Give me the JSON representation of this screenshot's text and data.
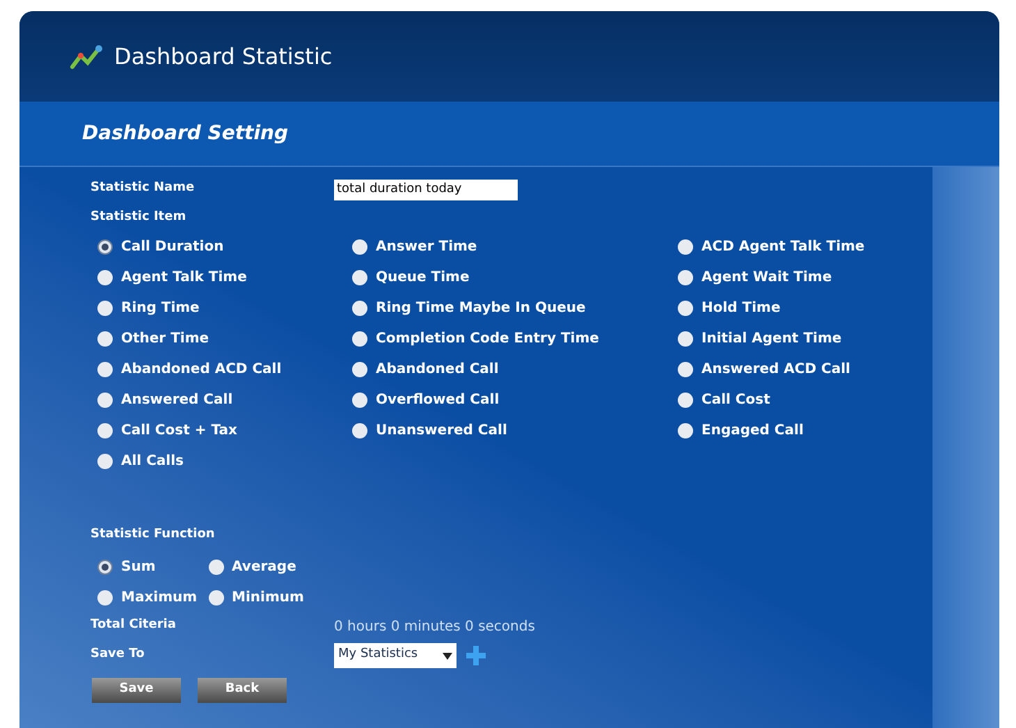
{
  "app": {
    "title": "Dashboard Statistic"
  },
  "section": {
    "title": "Dashboard Setting"
  },
  "statistic_name": {
    "label": "Statistic Name",
    "value": "total duration today"
  },
  "statistic_item": {
    "label": "Statistic Item",
    "options": [
      {
        "label": "Call Duration",
        "selected": true
      },
      {
        "label": "Answer Time",
        "selected": false
      },
      {
        "label": "ACD Agent Talk Time",
        "selected": false
      },
      {
        "label": "Agent Talk Time",
        "selected": false
      },
      {
        "label": "Queue Time",
        "selected": false
      },
      {
        "label": "Agent Wait Time",
        "selected": false
      },
      {
        "label": "Ring Time",
        "selected": false
      },
      {
        "label": "Ring Time Maybe In Queue",
        "selected": false
      },
      {
        "label": "Hold Time",
        "selected": false
      },
      {
        "label": "Other Time",
        "selected": false
      },
      {
        "label": "Completion Code Entry Time",
        "selected": false
      },
      {
        "label": "Initial Agent Time",
        "selected": false
      },
      {
        "label": "Abandoned ACD Call",
        "selected": false
      },
      {
        "label": "Abandoned Call",
        "selected": false
      },
      {
        "label": "Answered ACD Call",
        "selected": false
      },
      {
        "label": "Answered Call",
        "selected": false
      },
      {
        "label": "Overflowed Call",
        "selected": false
      },
      {
        "label": "Call Cost",
        "selected": false
      },
      {
        "label": "Call Cost + Tax",
        "selected": false
      },
      {
        "label": "Unanswered Call",
        "selected": false
      },
      {
        "label": "Engaged Call",
        "selected": false
      },
      {
        "label": "All Calls",
        "selected": false
      }
    ]
  },
  "statistic_function": {
    "label": "Statistic Function",
    "options": [
      {
        "label": "Sum",
        "selected": true
      },
      {
        "label": "Average",
        "selected": false
      },
      {
        "label": "Maximum",
        "selected": false
      },
      {
        "label": "Minimum",
        "selected": false
      }
    ]
  },
  "total_criteria": {
    "label": "Total Citeria",
    "value": "0 hours 0 minutes 0 seconds"
  },
  "save_to": {
    "label": "Save To",
    "value": "My Statistics"
  },
  "buttons": [
    "Save",
    "Back"
  ]
}
